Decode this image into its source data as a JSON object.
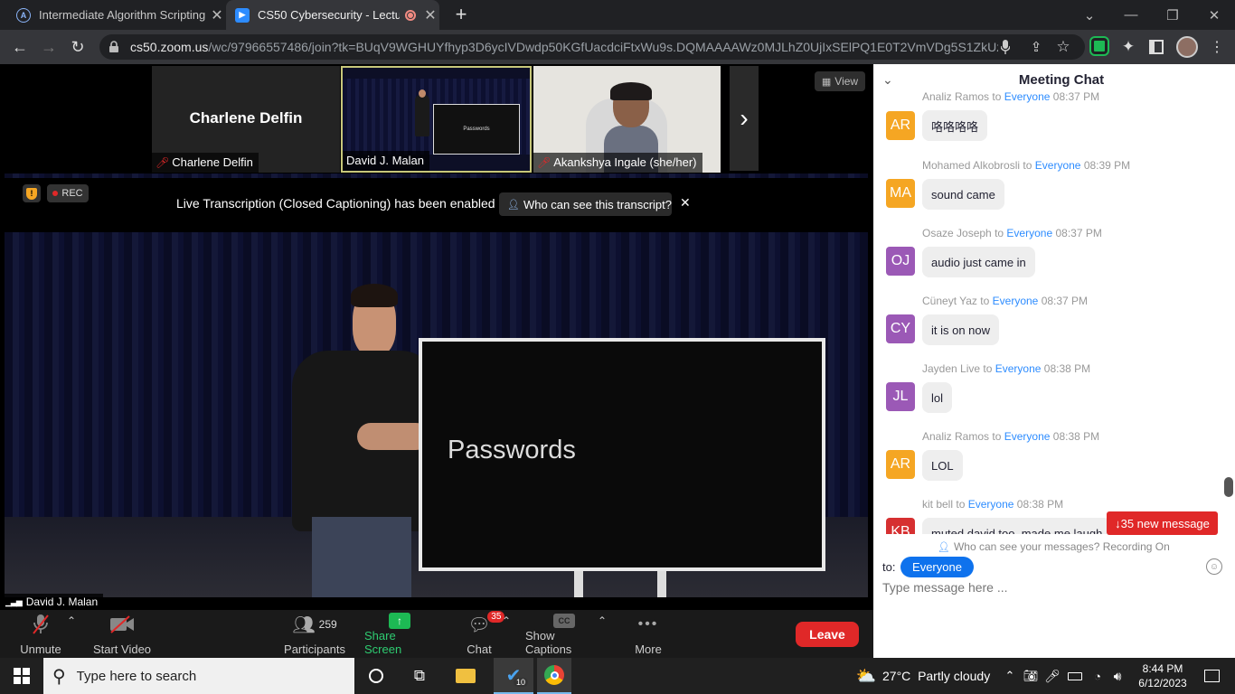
{
  "browser": {
    "tabs": [
      {
        "title": "Intermediate Algorithm Scripting",
        "favicon": "A"
      },
      {
        "title": "CS50 Cybersecurity - Lecture"
      }
    ],
    "new_tab_label": "+",
    "url_host": "cs50.zoom.us",
    "url_path": "/wc/97966557486/join?tk=BUqV9WGHUYfhyp3D6ycIVDwdp50KGfUacdciFtxWu9s.DQMAAAAWz0MJLhZ0UjIxSElPQ1E0T2VmVDg5S1ZkUzZ..."
  },
  "meeting": {
    "view_label": "View",
    "participants_strip": [
      {
        "name": "Charlene Delfin",
        "display": "Charlene Delfin",
        "muted": true
      },
      {
        "name": "David J. Malan",
        "muted": false,
        "active": true
      },
      {
        "name": "Akankshya Ingale (she/her)",
        "muted": true
      }
    ],
    "rec_label": "REC",
    "transcript_banner": "Live Transcription (Closed Captioning) has been enabled",
    "transcript_button": "Who can see this transcript?",
    "stage_slide_text": "Passwords",
    "thumb_slide_text": "Passwords",
    "speaker_name": "David J. Malan",
    "controls": {
      "unmute": "Unmute",
      "start_video": "Start Video",
      "participants": "Participants",
      "participants_count": "259",
      "share_screen": "Share Screen",
      "chat": "Chat",
      "chat_badge": "35",
      "captions": "Show Captions",
      "captions_icon": "CC",
      "more": "More",
      "leave": "Leave"
    }
  },
  "chat": {
    "title": "Meeting Chat",
    "to_word": "to",
    "top_partial": {
      "sender": "Analiz Ramos",
      "to": "Everyone",
      "time": "08:37 PM",
      "initials": "AR",
      "text": "咯咯咯咯"
    },
    "messages": [
      {
        "sender": "Mohamed Alkobrosli",
        "to": "Everyone",
        "time": "08:39 PM",
        "initials": "MA",
        "color": "#f5a623",
        "text": "sound came"
      },
      {
        "sender": "Osaze Joseph",
        "to": "Everyone",
        "time": "08:37 PM",
        "initials": "OJ",
        "color": "#9b59b6",
        "text": "audio just came in"
      },
      {
        "sender": "Cüneyt Yaz",
        "to": "Everyone",
        "time": "08:37 PM",
        "initials": "CY",
        "color": "#9b59b6",
        "text": "it is on now"
      },
      {
        "sender": "Jayden Live",
        "to": "Everyone",
        "time": "08:38 PM",
        "initials": "JL",
        "color": "#9b59b6",
        "text": "lol"
      },
      {
        "sender": "Analiz Ramos",
        "to": "Everyone",
        "time": "08:38 PM",
        "initials": "AR",
        "color": "#f5a623",
        "text": "LOL"
      },
      {
        "sender": "kit bell",
        "to": "Everyone",
        "time": "08:38 PM",
        "initials": "KB",
        "color": "#d63031",
        "text": "muted david too, made me laugh"
      }
    ],
    "new_messages": "↓35 new message",
    "privacy_note": "Who can see your messages? Recording On",
    "to_label": "to:",
    "recipient": "Everyone",
    "input_placeholder": "Type message here ..."
  },
  "taskbar": {
    "search_placeholder": "Type here to search",
    "weather_temp": "27°C",
    "weather_text": "Partly cloudy",
    "time": "8:44 PM",
    "date": "6/12/2023",
    "vscode_badge": "10"
  }
}
